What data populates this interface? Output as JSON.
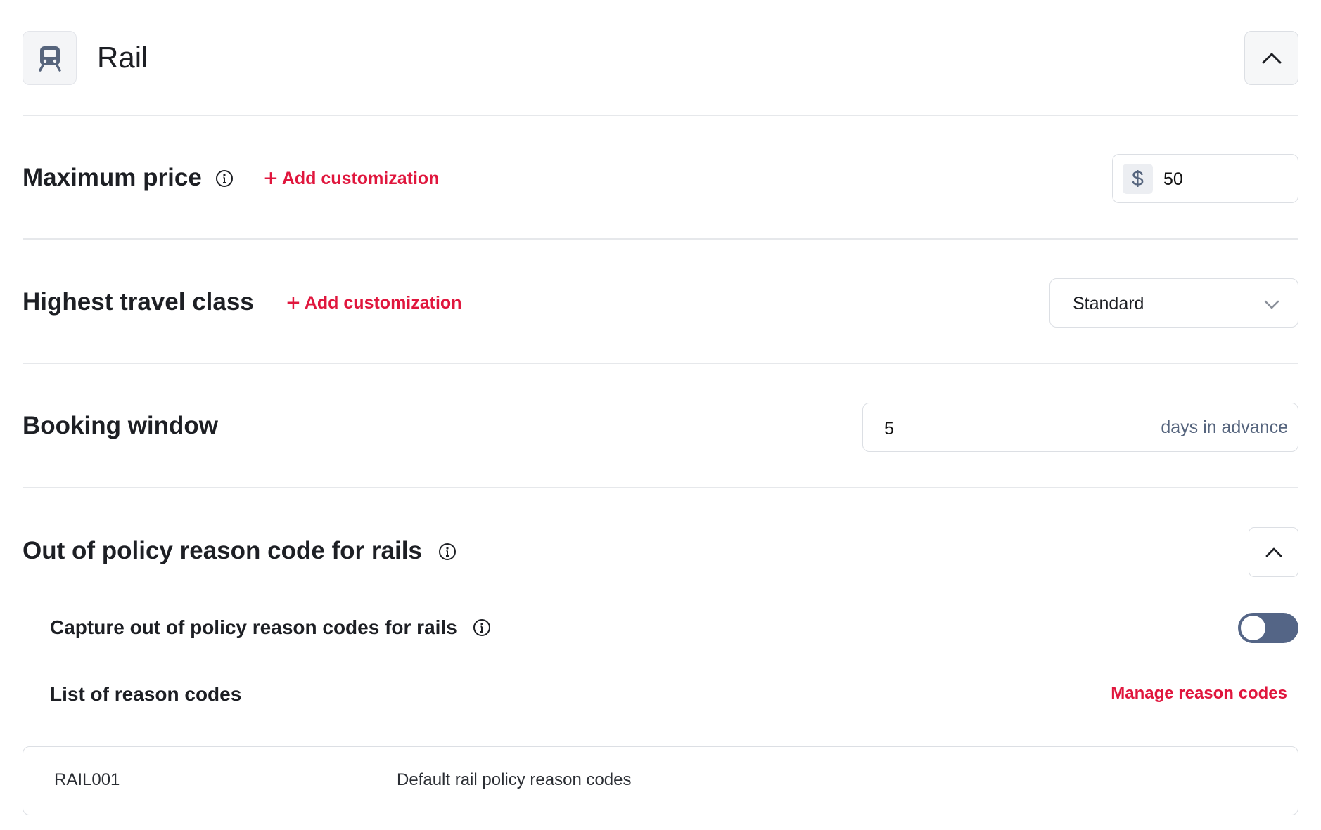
{
  "header": {
    "title": "Rail",
    "icon": "train-icon",
    "collapse_icon": "chevron-up-icon"
  },
  "max_price": {
    "label": "Maximum price",
    "add_customization": "Add customization",
    "currency_symbol": "$",
    "value": "50"
  },
  "travel_class": {
    "label": "Highest travel class",
    "add_customization": "Add customization",
    "selected": "Standard"
  },
  "booking_window": {
    "label": "Booking window",
    "value": "5",
    "suffix": "days in advance"
  },
  "reason_codes": {
    "section_label": "Out of policy reason code for rails",
    "capture_label": "Capture out of policy reason codes for rails",
    "capture_enabled": false,
    "list_label": "List of reason codes",
    "manage_link": "Manage reason codes",
    "rows": [
      {
        "code": "RAIL001",
        "description": "Default rail policy reason codes"
      }
    ]
  },
  "colors": {
    "accent_red": "#e0163d",
    "toggle_off": "#546586",
    "text_dark": "#1d1f24",
    "border": "#dcdfe4"
  }
}
